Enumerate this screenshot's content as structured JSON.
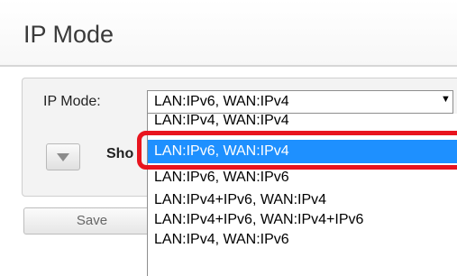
{
  "page": {
    "title": "IP Mode"
  },
  "form": {
    "ip_mode_label": "IP Mode:",
    "ip_mode_value": "LAN:IPv6, WAN:IPv4",
    "select_arrow": "▼",
    "show_text": "Sho",
    "save_label": "Save"
  },
  "dropdown": {
    "options": [
      {
        "label": "LAN:IPv4, WAN:IPv4"
      },
      {
        "label": "LAN:IPv6, WAN:IPv4"
      },
      {
        "label": "LAN:IPv6, WAN:IPv6"
      },
      {
        "label": "LAN:IPv4+IPv6, WAN:IPv4"
      },
      {
        "label": "LAN:IPv4+IPv6, WAN:IPv4+IPv6"
      },
      {
        "label": "LAN:IPv4, WAN:IPv6"
      }
    ],
    "selected_index": 1
  },
  "annotation": {
    "highlight_color": "#e8141e"
  },
  "colors": {
    "selection": "#1e90ff"
  }
}
